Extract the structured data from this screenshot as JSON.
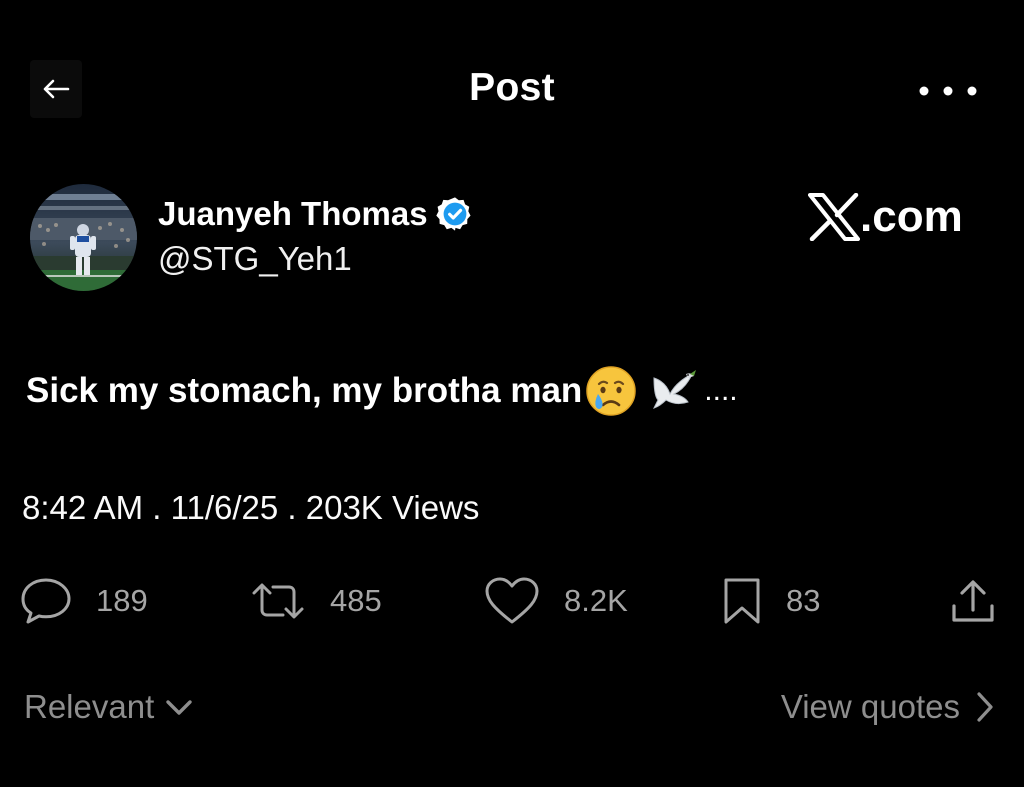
{
  "header": {
    "title": "Post",
    "back_icon": "arrow-left-icon",
    "more_icon": "more-horizontal-icon"
  },
  "author": {
    "name": "Juanyeh Thomas",
    "handle": "@STG_Yeh1",
    "verified": true,
    "verified_color": "#1d9bf0"
  },
  "brand": {
    "logo_icon": "x-logo-icon",
    "suffix": ".com"
  },
  "post": {
    "text": "Sick my stomach, my brotha man",
    "emojis": [
      "crying-face-icon",
      "dove-icon"
    ],
    "suffix": "....",
    "meta": "8:42 AM . 11/6/25 . 203K Views"
  },
  "actions": {
    "replies": "189",
    "reposts": "485",
    "likes": "8.2K",
    "bookmarks": "83",
    "share_icon": "share-icon"
  },
  "footer": {
    "sort_label": "Relevant",
    "quotes_label": "View quotes"
  },
  "colors": {
    "background": "#000000",
    "text": "#ffffff",
    "muted": "#8e8e8e",
    "action": "#a5a5a5"
  }
}
